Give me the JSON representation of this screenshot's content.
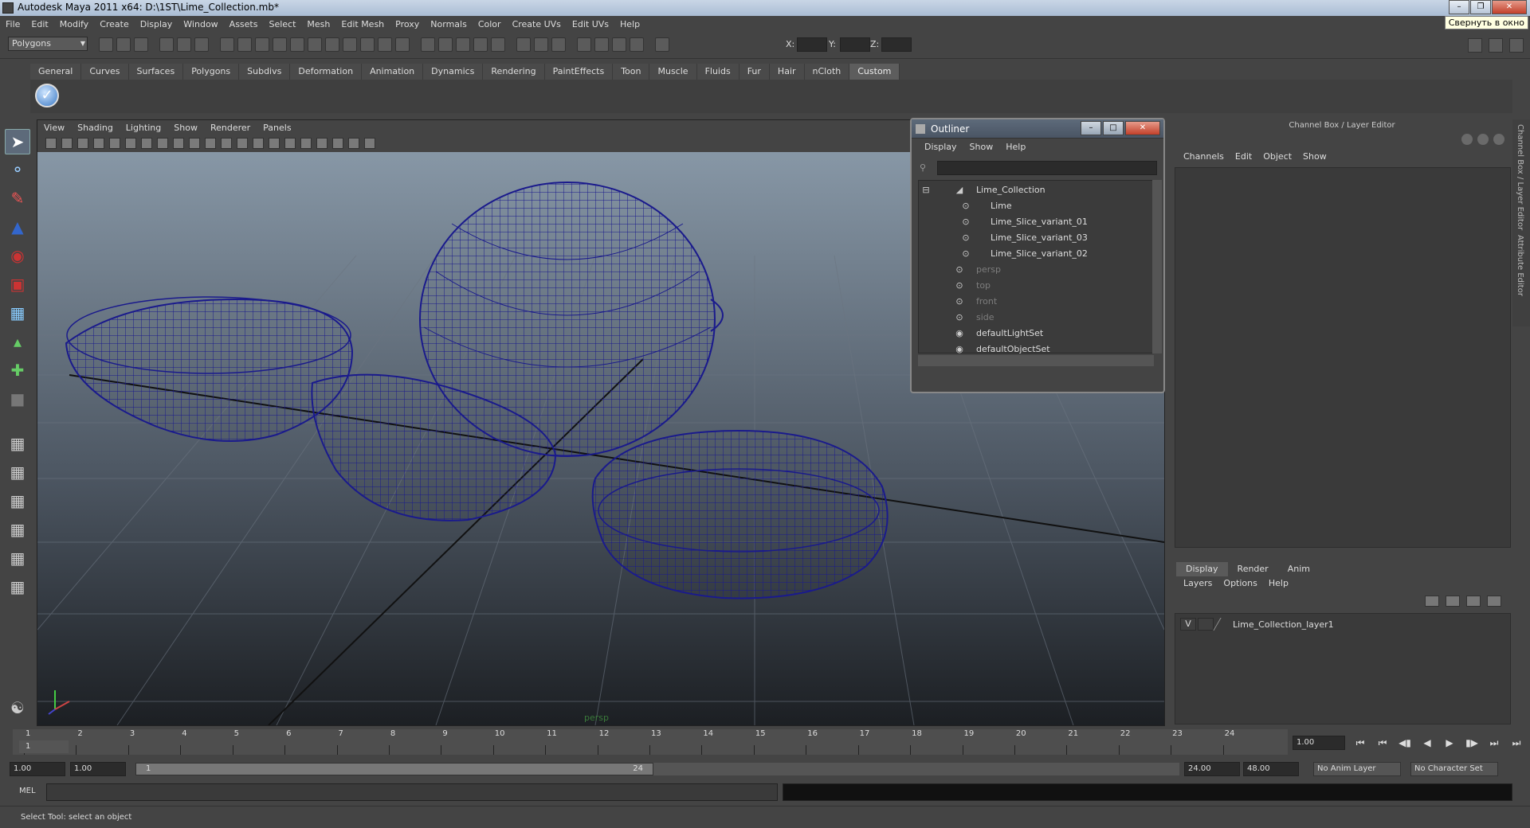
{
  "window": {
    "title": "Autodesk Maya 2011 x64: D:\\1ST\\Lime_Collection.mb*",
    "tooltip": "Свернуть в окно"
  },
  "menubar": [
    "File",
    "Edit",
    "Modify",
    "Create",
    "Display",
    "Window",
    "Assets",
    "Select",
    "Mesh",
    "Edit Mesh",
    "Proxy",
    "Normals",
    "Color",
    "Create UVs",
    "Edit UVs",
    "Help"
  ],
  "statusline": {
    "mode": "Polygons",
    "x_label": "X:",
    "y_label": "Y:",
    "z_label": "Z:"
  },
  "shelf": {
    "tabs": [
      "General",
      "Curves",
      "Surfaces",
      "Polygons",
      "Subdivs",
      "Deformation",
      "Animation",
      "Dynamics",
      "Rendering",
      "PaintEffects",
      "Toon",
      "Muscle",
      "Fluids",
      "Fur",
      "Hair",
      "nCloth",
      "Custom"
    ],
    "active": "Custom"
  },
  "viewport": {
    "menu": [
      "View",
      "Shading",
      "Lighting",
      "Show",
      "Renderer",
      "Panels"
    ],
    "camera_label": "persp",
    "wire_color": "#1a1a8c"
  },
  "outliner": {
    "title": "Outliner",
    "menu": [
      "Display",
      "Show",
      "Help"
    ],
    "items": [
      {
        "label": "Lime_Collection",
        "indent": 0,
        "dim": false
      },
      {
        "label": "Lime",
        "indent": 1,
        "dim": false
      },
      {
        "label": "Lime_Slice_variant_01",
        "indent": 1,
        "dim": false
      },
      {
        "label": "Lime_Slice_variant_03",
        "indent": 1,
        "dim": false
      },
      {
        "label": "Lime_Slice_variant_02",
        "indent": 1,
        "dim": false
      },
      {
        "label": "persp",
        "indent": 0,
        "dim": true
      },
      {
        "label": "top",
        "indent": 0,
        "dim": true
      },
      {
        "label": "front",
        "indent": 0,
        "dim": true
      },
      {
        "label": "side",
        "indent": 0,
        "dim": true
      },
      {
        "label": "defaultLightSet",
        "indent": 0,
        "dim": false
      },
      {
        "label": "defaultObjectSet",
        "indent": 0,
        "dim": false
      }
    ]
  },
  "channelbox": {
    "title": "Channel Box / Layer Editor",
    "menu": [
      "Channels",
      "Edit",
      "Object",
      "Show"
    ],
    "side_tabs": [
      "Channel Box / Layer Editor",
      "Attribute Editor"
    ]
  },
  "layers": {
    "tabs": [
      "Display",
      "Render",
      "Anim"
    ],
    "active": "Display",
    "menu": [
      "Layers",
      "Options",
      "Help"
    ],
    "row": {
      "visible": "V",
      "name": "Lime_Collection_layer1"
    }
  },
  "timeslider": {
    "ticks": [
      "1",
      "2",
      "3",
      "4",
      "5",
      "6",
      "7",
      "8",
      "9",
      "10",
      "11",
      "12",
      "13",
      "14",
      "15",
      "16",
      "17",
      "18",
      "19",
      "20",
      "21",
      "22",
      "23",
      "24"
    ],
    "current_frame": "1",
    "current_field": "1.00"
  },
  "range": {
    "start": "1.00",
    "min": "1.00",
    "handle_start": "1",
    "handle_end": "24",
    "end": "24.00",
    "max": "48.00",
    "anim_layer": "No Anim Layer",
    "char_set": "No Character Set"
  },
  "cmdline": {
    "label": "MEL",
    "help": "Select Tool: select an object"
  }
}
